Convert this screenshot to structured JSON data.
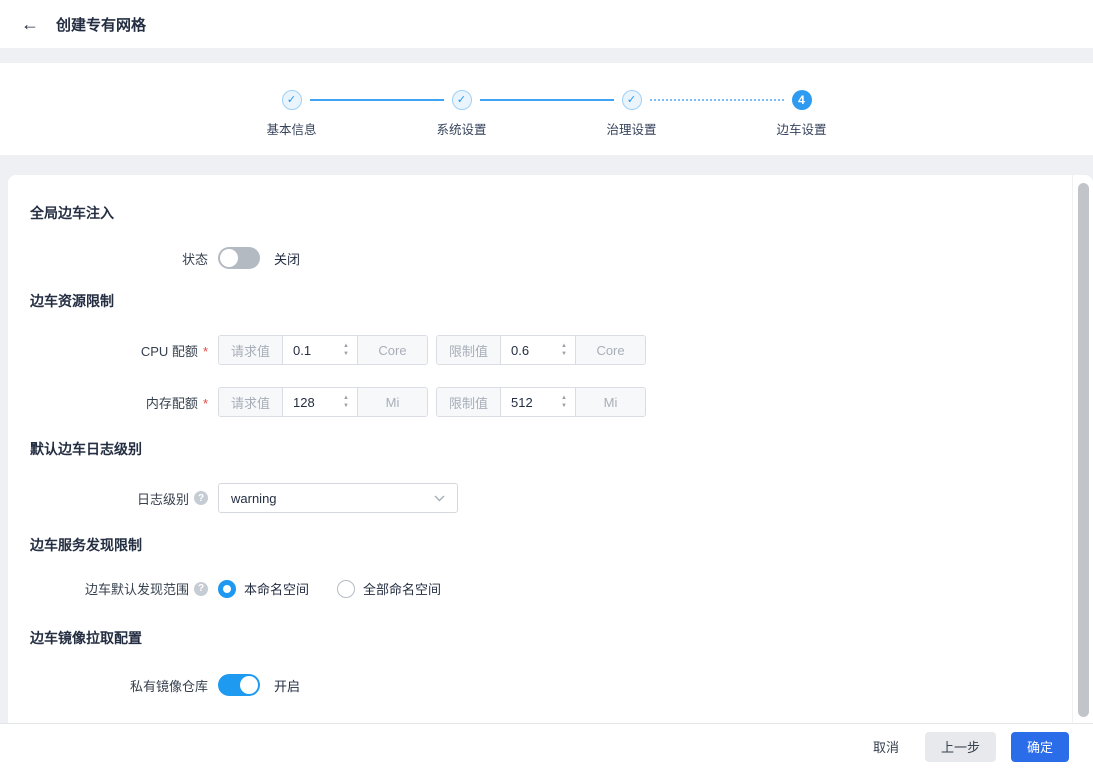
{
  "colors": {
    "accent_blue": "#2196f3",
    "primary_button_blue": "#2b6ce8",
    "required_red": "#ea4641",
    "page_background": "#eef0f4",
    "toggle_off_gray": "#b3bac2"
  },
  "header": {
    "back_icon": "arrow-left",
    "title": "创建专有网格"
  },
  "stepper": {
    "steps": [
      {
        "label": "基本信息",
        "state": "done",
        "icon": "check-circle"
      },
      {
        "label": "系统设置",
        "state": "done",
        "icon": "check-circle"
      },
      {
        "label": "治理设置",
        "state": "done",
        "icon": "check-circle"
      },
      {
        "label": "边车设置",
        "state": "active",
        "number": "4"
      }
    ]
  },
  "form": {
    "global_injection": {
      "title": "全局边车注入",
      "status_label": "状态",
      "status_text": "关闭",
      "status_enabled": false
    },
    "resource_limits": {
      "title": "边车资源限制",
      "cpu": {
        "label": "CPU 配额",
        "required_mark": "*",
        "request_addon": "请求值",
        "request_value": "0.1",
        "request_unit": "Core",
        "limit_addon": "限制值",
        "limit_value": "0.6",
        "limit_unit": "Core"
      },
      "memory": {
        "label": "内存配额",
        "required_mark": "*",
        "request_addon": "请求值",
        "request_value": "128",
        "request_unit": "Mi",
        "limit_addon": "限制值",
        "limit_value": "512",
        "limit_unit": "Mi"
      }
    },
    "log_level": {
      "title": "默认边车日志级别",
      "label": "日志级别",
      "help_icon": "question-circle",
      "selected_value": "warning"
    },
    "service_discovery": {
      "title": "边车服务发现限制",
      "label": "边车默认发现范围",
      "help_icon": "question-circle",
      "options": [
        {
          "label": "本命名空间",
          "selected": true
        },
        {
          "label": "全部命名空间",
          "selected": false
        }
      ]
    },
    "image_pull": {
      "title": "边车镜像拉取配置",
      "label": "私有镜像仓库",
      "status_text": "开启",
      "status_enabled": true
    }
  },
  "footer": {
    "cancel_label": "取消",
    "previous_label": "上一步",
    "confirm_label": "确定"
  }
}
